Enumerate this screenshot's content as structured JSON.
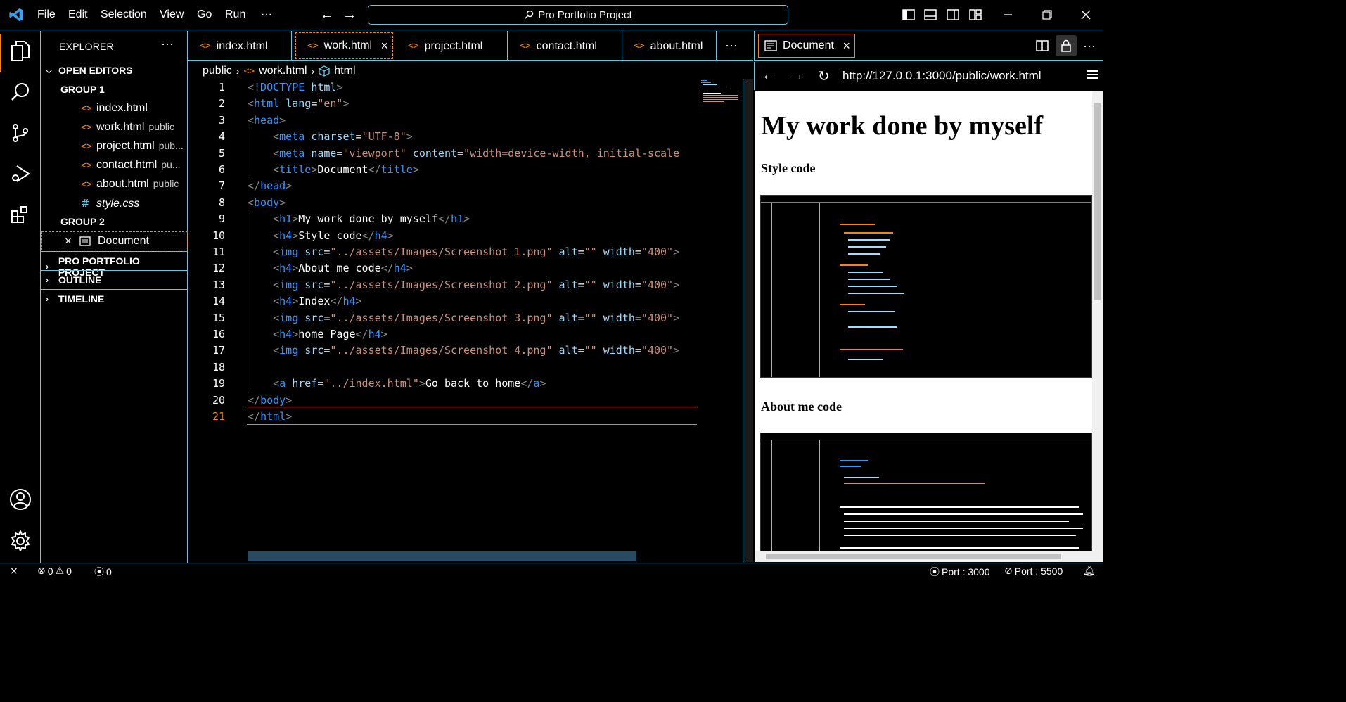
{
  "titlebar": {
    "menus": [
      "File",
      "Edit",
      "Selection",
      "View",
      "Go",
      "Run"
    ],
    "more": "···",
    "search_label": "Pro Portfolio Project",
    "icons": [
      "vscode-logo-icon",
      "back-arrow-icon",
      "forward-arrow-icon",
      "search-icon",
      "toggle-primary-sidebar-icon",
      "toggle-panel-icon",
      "toggle-secondary-sidebar-icon",
      "customize-layout-icon",
      "minimize-icon",
      "restore-icon",
      "close-icon"
    ]
  },
  "activitybar": {
    "items": [
      "explorer-icon",
      "search-icon",
      "source-control-icon",
      "run-debug-icon",
      "extensions-icon"
    ],
    "bottom": [
      "accounts-icon",
      "manage-gear-icon"
    ]
  },
  "sidebar": {
    "title": "EXPLORER",
    "more": "···",
    "open_editors": "OPEN EDITORS",
    "group1": "GROUP 1",
    "group1_files": [
      {
        "name": "index.html",
        "desc": ""
      },
      {
        "name": "work.html",
        "desc": "public"
      },
      {
        "name": "project.html",
        "desc": "pub..."
      },
      {
        "name": "contact.html",
        "desc": "pu..."
      },
      {
        "name": "about.html",
        "desc": "public"
      },
      {
        "name": "style.css",
        "desc": ""
      }
    ],
    "group2": "GROUP 2",
    "group2_file": "Document",
    "project": "PRO PORTFOLIO PROJECT",
    "outline": "OUTLINE",
    "timeline": "TIMELINE"
  },
  "tabs": [
    "index.html",
    "work.html",
    "project.html",
    "contact.html",
    "about.html"
  ],
  "tabs_more": "···",
  "breadcrumb": [
    "public",
    "work.html",
    "html"
  ],
  "editor": {
    "line_numbers": [
      "1",
      "2",
      "3",
      "4",
      "5",
      "6",
      "7",
      "8",
      "9",
      "10",
      "11",
      "12",
      "13",
      "14",
      "15",
      "16",
      "17",
      "18",
      "19",
      "20",
      "21"
    ],
    "current_line": "21",
    "lines": [
      "<!DOCTYPE html>",
      "<html lang=\"en\">",
      "<head>",
      "    <meta charset=\"UTF-8\">",
      "    <meta name=\"viewport\" content=\"width=device-width, initial-scale",
      "    <title>Document</title>",
      "</head>",
      "<body>",
      "    <h1>My work done by myself</h1>",
      "    <h4>Style code</h4>",
      "    <img src=\"../assets/Images/Screenshot 1.png\" alt=\"\" width=\"400\">",
      "    <h4>About me code</h4>",
      "    <img src=\"../assets/Images/Screenshot 2.png\" alt=\"\" width=\"400\">",
      "    <h4>Index</h4>",
      "    <img src=\"../assets/Images/Screenshot 3.png\" alt=\"\" width=\"400\">",
      "    <h4>home Page</h4>",
      "    <img src=\"../assets/Images/Screenshot 4.png\" alt=\"\" width=\"400\">",
      "",
      "    <a href=\"../index.html\">Go back to home</a>",
      "</body>",
      "</html>"
    ]
  },
  "preview": {
    "tab_label": "Document",
    "url": "http://127.0.0.1:3000/public/work.html",
    "h1": "My work done by myself",
    "sections": [
      "Style code",
      "About me code"
    ]
  },
  "statusbar": {
    "errors": "0",
    "warnings": "0",
    "ports_count": "0",
    "port_live": "Port : 3000",
    "port_off": "Port : 5500"
  },
  "colors": {
    "accent": "#6fc3df",
    "active": "#f38518",
    "tag": "#3794ff",
    "attr": "#9cdcfe",
    "string": "#ce9178"
  }
}
